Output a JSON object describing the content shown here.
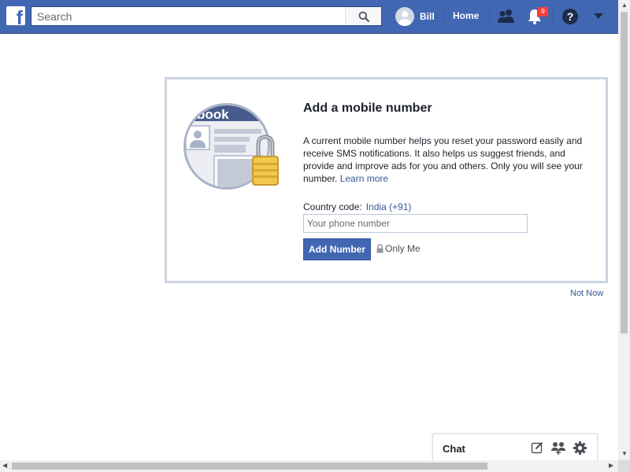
{
  "header": {
    "logo_letter": "f",
    "search": {
      "placeholder": "Search",
      "value": ""
    },
    "user_name": "Bill",
    "home_label": "Home",
    "notification_count": "9",
    "colors": {
      "brand": "#4267b2",
      "badge": "#fa3e3e"
    },
    "icons": [
      "facebook-logo-icon",
      "search-icon",
      "avatar",
      "friend-requests-icon",
      "notifications-icon",
      "help-icon",
      "account-menu-chevron-icon"
    ]
  },
  "card": {
    "title": "Add a mobile number",
    "description": "A current mobile number helps you reset your password easily and receive SMS notifications. It also helps us suggest friends, and provide and improve ads for you and others. Only you will see your number.",
    "learn_more": "Learn more",
    "country_code_label": "Country code:",
    "country_code_value": "India (+91)",
    "phone": {
      "placeholder": "Your phone number",
      "value": ""
    },
    "add_button": "Add Number",
    "privacy_label": "Only Me",
    "illustration_text": "book"
  },
  "not_now": "Not Now",
  "chat": {
    "label": "Chat",
    "icons": [
      "compose-icon",
      "group-icon",
      "gear-icon"
    ]
  }
}
